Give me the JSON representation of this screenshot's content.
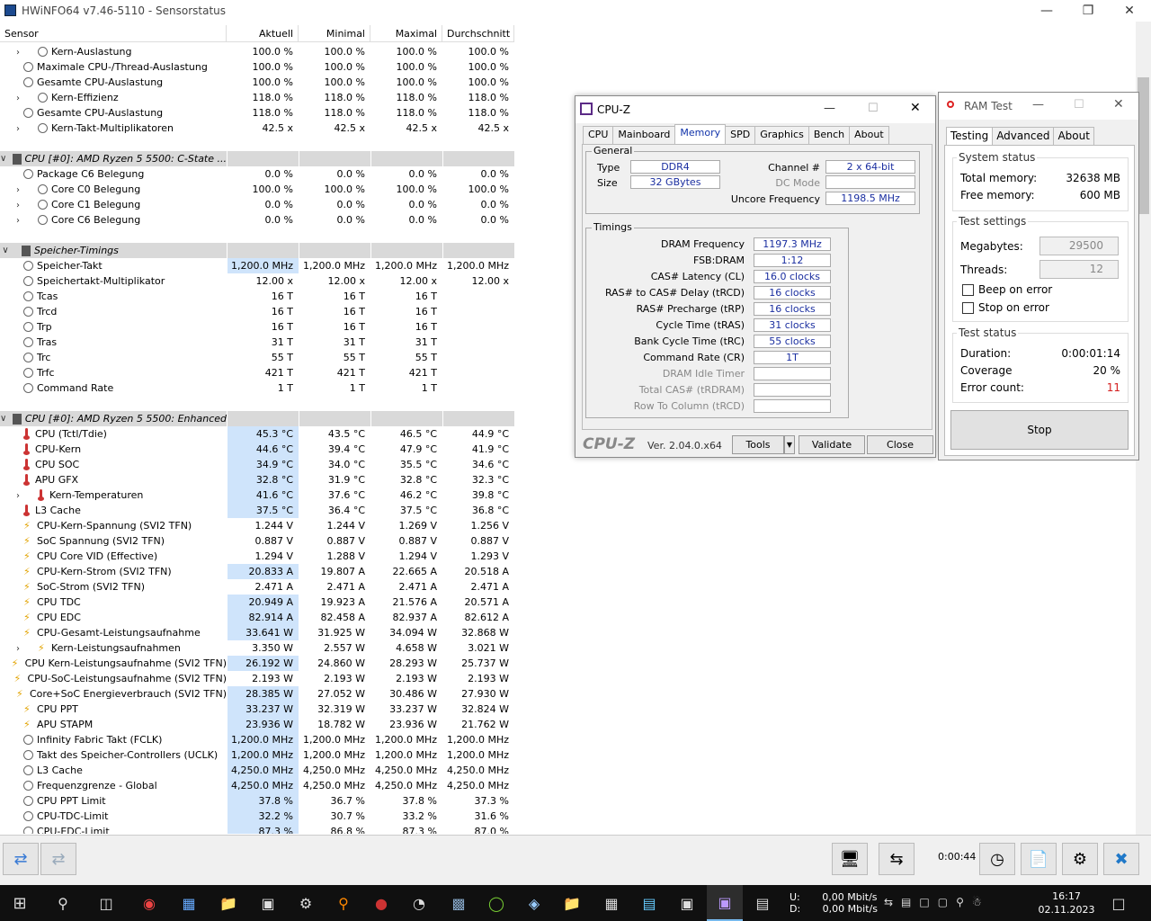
{
  "hwinfo": {
    "title": "HWiNFO64 v7.46-5110 - Sensorstatus",
    "columns": [
      "Sensor",
      "Aktuell",
      "Minimal",
      "Maximal",
      "Durchschnitt"
    ],
    "rows": [
      {
        "type": "item",
        "icon": "circle",
        "exp": ">",
        "indent": 2,
        "name": "Kern-Auslastung",
        "vals": [
          "100.0 %",
          "100.0 %",
          "100.0 %",
          "100.0 %"
        ]
      },
      {
        "type": "item",
        "icon": "circle",
        "indent": 1,
        "name": "Maximale CPU-/Thread-Auslastung",
        "vals": [
          "100.0 %",
          "100.0 %",
          "100.0 %",
          "100.0 %"
        ]
      },
      {
        "type": "item",
        "icon": "circle",
        "indent": 1,
        "name": "Gesamte CPU-Auslastung",
        "vals": [
          "100.0 %",
          "100.0 %",
          "100.0 %",
          "100.0 %"
        ]
      },
      {
        "type": "item",
        "icon": "circle",
        "exp": ">",
        "indent": 2,
        "name": "Kern-Effizienz",
        "vals": [
          "118.0 %",
          "118.0 %",
          "118.0 %",
          "118.0 %"
        ]
      },
      {
        "type": "item",
        "icon": "circle",
        "indent": 1,
        "name": "Gesamte CPU-Auslastung",
        "vals": [
          "118.0 %",
          "118.0 %",
          "118.0 %",
          "118.0 %"
        ]
      },
      {
        "type": "item",
        "icon": "circle",
        "exp": ">",
        "indent": 2,
        "name": "Kern-Takt-Multiplikatoren",
        "vals": [
          "42.5 x",
          "42.5 x",
          "42.5 x",
          "42.5 x"
        ]
      },
      {
        "type": "blank"
      },
      {
        "type": "group",
        "name": "CPU [#0]: AMD Ryzen 5 5500: C-State ..."
      },
      {
        "type": "item",
        "icon": "circle",
        "indent": 1,
        "name": "Package C6 Belegung",
        "vals": [
          "0.0 %",
          "0.0 %",
          "0.0 %",
          "0.0 %"
        ]
      },
      {
        "type": "item",
        "icon": "circle",
        "exp": ">",
        "indent": 2,
        "name": "Core C0 Belegung",
        "vals": [
          "100.0 %",
          "100.0 %",
          "100.0 %",
          "100.0 %"
        ]
      },
      {
        "type": "item",
        "icon": "circle",
        "exp": ">",
        "indent": 2,
        "name": "Core C1 Belegung",
        "vals": [
          "0.0 %",
          "0.0 %",
          "0.0 %",
          "0.0 %"
        ]
      },
      {
        "type": "item",
        "icon": "circle",
        "exp": ">",
        "indent": 2,
        "name": "Core C6 Belegung",
        "vals": [
          "0.0 %",
          "0.0 %",
          "0.0 %",
          "0.0 %"
        ]
      },
      {
        "type": "blank"
      },
      {
        "type": "group",
        "name": "Speicher-Timings"
      },
      {
        "type": "item",
        "icon": "circle",
        "indent": 1,
        "hl": true,
        "name": "Speicher-Takt",
        "vals": [
          "1,200.0 MHz",
          "1,200.0 MHz",
          "1,200.0 MHz",
          "1,200.0 MHz"
        ]
      },
      {
        "type": "item",
        "icon": "circle",
        "indent": 1,
        "name": "Speichertakt-Multiplikator",
        "vals": [
          "12.00 x",
          "12.00 x",
          "12.00 x",
          "12.00 x"
        ]
      },
      {
        "type": "item",
        "icon": "circle",
        "indent": 1,
        "name": "Tcas",
        "vals": [
          "16 T",
          "16 T",
          "16 T",
          ""
        ]
      },
      {
        "type": "item",
        "icon": "circle",
        "indent": 1,
        "name": "Trcd",
        "vals": [
          "16 T",
          "16 T",
          "16 T",
          ""
        ]
      },
      {
        "type": "item",
        "icon": "circle",
        "indent": 1,
        "name": "Trp",
        "vals": [
          "16 T",
          "16 T",
          "16 T",
          ""
        ]
      },
      {
        "type": "item",
        "icon": "circle",
        "indent": 1,
        "name": "Tras",
        "vals": [
          "31 T",
          "31 T",
          "31 T",
          ""
        ]
      },
      {
        "type": "item",
        "icon": "circle",
        "indent": 1,
        "name": "Trc",
        "vals": [
          "55 T",
          "55 T",
          "55 T",
          ""
        ]
      },
      {
        "type": "item",
        "icon": "circle",
        "indent": 1,
        "name": "Trfc",
        "vals": [
          "421 T",
          "421 T",
          "421 T",
          ""
        ]
      },
      {
        "type": "item",
        "icon": "circle",
        "indent": 1,
        "name": "Command Rate",
        "vals": [
          "1 T",
          "1 T",
          "1 T",
          ""
        ]
      },
      {
        "type": "blank"
      },
      {
        "type": "group",
        "name": "CPU [#0]: AMD Ryzen 5 5500: Enhanced"
      },
      {
        "type": "item",
        "icon": "therm",
        "indent": 1,
        "hl": true,
        "name": "CPU (Tctl/Tdie)",
        "vals": [
          "45.3 °C",
          "43.5 °C",
          "46.5 °C",
          "44.9 °C"
        ]
      },
      {
        "type": "item",
        "icon": "therm",
        "indent": 1,
        "hl": true,
        "name": "CPU-Kern",
        "vals": [
          "44.6 °C",
          "39.4 °C",
          "47.9 °C",
          "41.9 °C"
        ]
      },
      {
        "type": "item",
        "icon": "therm",
        "indent": 1,
        "hl": true,
        "name": "CPU SOC",
        "vals": [
          "34.9 °C",
          "34.0 °C",
          "35.5 °C",
          "34.6 °C"
        ]
      },
      {
        "type": "item",
        "icon": "therm",
        "indent": 1,
        "hl": true,
        "name": "APU GFX",
        "vals": [
          "32.8 °C",
          "31.9 °C",
          "32.8 °C",
          "32.3 °C"
        ]
      },
      {
        "type": "item",
        "icon": "therm",
        "exp": ">",
        "indent": 2,
        "hl": true,
        "name": "Kern-Temperaturen",
        "vals": [
          "41.6 °C",
          "37.6 °C",
          "46.2 °C",
          "39.8 °C"
        ]
      },
      {
        "type": "item",
        "icon": "therm",
        "indent": 1,
        "hl": true,
        "name": "L3 Cache",
        "vals": [
          "37.5 °C",
          "36.4 °C",
          "37.5 °C",
          "36.8 °C"
        ]
      },
      {
        "type": "item",
        "icon": "bolt",
        "indent": 1,
        "name": "CPU-Kern-Spannung (SVI2 TFN)",
        "vals": [
          "1.244 V",
          "1.244 V",
          "1.269 V",
          "1.256 V"
        ]
      },
      {
        "type": "item",
        "icon": "bolt",
        "indent": 1,
        "name": "SoC Spannung (SVI2 TFN)",
        "vals": [
          "0.887 V",
          "0.887 V",
          "0.887 V",
          "0.887 V"
        ]
      },
      {
        "type": "item",
        "icon": "bolt",
        "indent": 1,
        "name": "CPU Core VID (Effective)",
        "vals": [
          "1.294 V",
          "1.288 V",
          "1.294 V",
          "1.293 V"
        ]
      },
      {
        "type": "item",
        "icon": "bolt",
        "indent": 1,
        "hl": true,
        "name": "CPU-Kern-Strom (SVI2 TFN)",
        "vals": [
          "20.833 A",
          "19.807 A",
          "22.665 A",
          "20.518 A"
        ]
      },
      {
        "type": "item",
        "icon": "bolt",
        "indent": 1,
        "name": "SoC-Strom (SVI2 TFN)",
        "vals": [
          "2.471 A",
          "2.471 A",
          "2.471 A",
          "2.471 A"
        ]
      },
      {
        "type": "item",
        "icon": "bolt",
        "indent": 1,
        "hl": true,
        "name": "CPU TDC",
        "vals": [
          "20.949 A",
          "19.923 A",
          "21.576 A",
          "20.571 A"
        ]
      },
      {
        "type": "item",
        "icon": "bolt",
        "indent": 1,
        "hl": true,
        "name": "CPU EDC",
        "vals": [
          "82.914 A",
          "82.458 A",
          "82.937 A",
          "82.612 A"
        ]
      },
      {
        "type": "item",
        "icon": "bolt",
        "indent": 1,
        "hl": true,
        "name": "CPU-Gesamt-Leistungsaufnahme",
        "vals": [
          "33.641 W",
          "31.925 W",
          "34.094 W",
          "32.868 W"
        ]
      },
      {
        "type": "item",
        "icon": "bolt",
        "exp": ">",
        "indent": 2,
        "name": "Kern-Leistungsaufnahmen",
        "vals": [
          "3.350 W",
          "2.557 W",
          "4.658 W",
          "3.021 W"
        ]
      },
      {
        "type": "item",
        "icon": "bolt",
        "indent": 1,
        "hl": true,
        "name": "CPU Kern-Leistungsaufnahme (SVI2 TFN)",
        "vals": [
          "26.192 W",
          "24.860 W",
          "28.293 W",
          "25.737 W"
        ]
      },
      {
        "type": "item",
        "icon": "bolt",
        "indent": 1,
        "name": "CPU-SoC-Leistungsaufnahme (SVI2 TFN)",
        "vals": [
          "2.193 W",
          "2.193 W",
          "2.193 W",
          "2.193 W"
        ]
      },
      {
        "type": "item",
        "icon": "bolt",
        "indent": 1,
        "hl": true,
        "name": "Core+SoC Energieverbrauch (SVI2 TFN)",
        "vals": [
          "28.385 W",
          "27.052 W",
          "30.486 W",
          "27.930 W"
        ]
      },
      {
        "type": "item",
        "icon": "bolt",
        "indent": 1,
        "hl": true,
        "name": "CPU PPT",
        "vals": [
          "33.237 W",
          "32.319 W",
          "33.237 W",
          "32.824 W"
        ]
      },
      {
        "type": "item",
        "icon": "bolt",
        "indent": 1,
        "hl": true,
        "name": "APU STAPM",
        "vals": [
          "23.936 W",
          "18.782 W",
          "23.936 W",
          "21.762 W"
        ]
      },
      {
        "type": "item",
        "icon": "circle",
        "indent": 1,
        "hl": true,
        "name": "Infinity Fabric Takt (FCLK)",
        "vals": [
          "1,200.0 MHz",
          "1,200.0 MHz",
          "1,200.0 MHz",
          "1,200.0 MHz"
        ]
      },
      {
        "type": "item",
        "icon": "circle",
        "indent": 1,
        "hl": true,
        "name": "Takt des Speicher-Controllers (UCLK)",
        "vals": [
          "1,200.0 MHz",
          "1,200.0 MHz",
          "1,200.0 MHz",
          "1,200.0 MHz"
        ]
      },
      {
        "type": "item",
        "icon": "circle",
        "indent": 1,
        "hl": true,
        "name": "L3 Cache",
        "vals": [
          "4,250.0 MHz",
          "4,250.0 MHz",
          "4,250.0 MHz",
          "4,250.0 MHz"
        ]
      },
      {
        "type": "item",
        "icon": "circle",
        "indent": 1,
        "hl": true,
        "name": "Frequenzgrenze - Global",
        "vals": [
          "4,250.0 MHz",
          "4,250.0 MHz",
          "4,250.0 MHz",
          "4,250.0 MHz"
        ]
      },
      {
        "type": "item",
        "icon": "circle",
        "indent": 1,
        "hl": true,
        "name": "CPU PPT Limit",
        "vals": [
          "37.8 %",
          "36.7 %",
          "37.8 %",
          "37.3 %"
        ]
      },
      {
        "type": "item",
        "icon": "circle",
        "indent": 1,
        "hl": true,
        "name": "CPU-TDC-Limit",
        "vals": [
          "32.2 %",
          "30.7 %",
          "33.2 %",
          "31.6 %"
        ]
      },
      {
        "type": "item",
        "icon": "circle",
        "indent": 1,
        "hl": true,
        "name": "CPU-EDC-Limit",
        "vals": [
          "87.3 %",
          "86.8 %",
          "87.3 %",
          "87.0 %"
        ]
      }
    ],
    "timer": "0:00:44"
  },
  "cpuz": {
    "title": "CPU-Z",
    "tabs": [
      "CPU",
      "Mainboard",
      "Memory",
      "SPD",
      "Graphics",
      "Bench",
      "About"
    ],
    "general_legend": "General",
    "type_label": "Type",
    "type_value": "DDR4",
    "size_label": "Size",
    "size_value": "32 GBytes",
    "channel_label": "Channel #",
    "channel_value": "2 x 64-bit",
    "dcmode_label": "DC Mode",
    "uncore_label": "Uncore Frequency",
    "uncore_value": "1198.5 MHz",
    "timings_legend": "Timings",
    "timings": [
      {
        "label": "DRAM Frequency",
        "value": "1197.3 MHz"
      },
      {
        "label": "FSB:DRAM",
        "value": "1:12"
      },
      {
        "label": "CAS# Latency (CL)",
        "value": "16.0 clocks"
      },
      {
        "label": "RAS# to CAS# Delay (tRCD)",
        "value": "16 clocks"
      },
      {
        "label": "RAS# Precharge (tRP)",
        "value": "16 clocks"
      },
      {
        "label": "Cycle Time (tRAS)",
        "value": "31 clocks"
      },
      {
        "label": "Bank Cycle Time (tRC)",
        "value": "55 clocks"
      },
      {
        "label": "Command Rate (CR)",
        "value": "1T"
      },
      {
        "label": "DRAM Idle Timer",
        "value": "",
        "dim": true
      },
      {
        "label": "Total CAS# (tRDRAM)",
        "value": "",
        "dim": true
      },
      {
        "label": "Row To Column (tRCD)",
        "value": "",
        "dim": true
      }
    ],
    "logo": "CPU-Z",
    "version": "Ver. 2.04.0.x64",
    "tools": "Tools",
    "validate": "Validate",
    "close": "Close"
  },
  "ramtest": {
    "title": "RAM Test",
    "tabs": [
      "Testing",
      "Advanced",
      "About"
    ],
    "system_status": "System status",
    "total_memory_label": "Total memory:",
    "total_memory": "32638 MB",
    "free_memory_label": "Free memory:",
    "free_memory": "600 MB",
    "test_settings": "Test settings",
    "megabytes_label": "Megabytes:",
    "megabytes": "29500",
    "threads_label": "Threads:",
    "threads": "12",
    "beep_label": "Beep on error",
    "stop_label": "Stop on error",
    "test_status": "Test status",
    "duration_label": "Duration:",
    "duration": "0:00:01:14",
    "coverage_label": "Coverage",
    "coverage": "20 %",
    "errors_label": "Error count:",
    "errors": "11",
    "stop_button": "Stop",
    "error_color": "#d42020"
  },
  "taskbar": {
    "upload": "U:",
    "download": "D:",
    "up_rate": "0,00 Mbit/s",
    "down_rate": "0,00 Mbit/s",
    "time": "16:17",
    "date": "02.11.2023"
  }
}
